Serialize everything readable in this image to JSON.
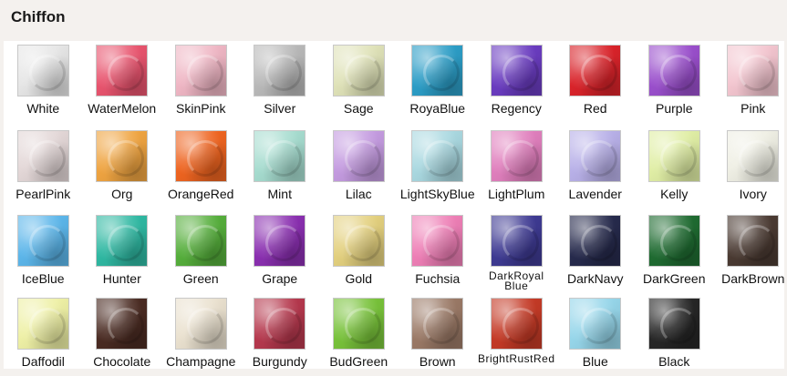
{
  "title": "Chiffon",
  "swatches": [
    {
      "label": "White",
      "color": "#e6e6e6"
    },
    {
      "label": "WaterMelon",
      "color": "#e8546e"
    },
    {
      "label": "SkinPink",
      "color": "#efb6c4"
    },
    {
      "label": "Silver",
      "color": "#b9b9b9"
    },
    {
      "label": "Sage",
      "color": "#dfe2b8"
    },
    {
      "label": "RoyaBlue",
      "color": "#2c9dc6"
    },
    {
      "label": "Regency",
      "color": "#6a3cc0"
    },
    {
      "label": "Red",
      "color": "#d9232a"
    },
    {
      "label": "Purple",
      "color": "#9a4fcc"
    },
    {
      "label": "Pink",
      "color": "#f3c5cf"
    },
    {
      "label": "PearlPink",
      "color": "#e3d7d7"
    },
    {
      "label": "Org",
      "color": "#efa441"
    },
    {
      "label": "OrangeRed",
      "color": "#ee6420"
    },
    {
      "label": "Mint",
      "color": "#a6dccf"
    },
    {
      "label": "Lilac",
      "color": "#c49be0"
    },
    {
      "label": "LightSkyBlue",
      "color": "#a9d8e0"
    },
    {
      "label": "LightPlum",
      "color": "#e07fbd"
    },
    {
      "label": "Lavender",
      "color": "#b8b0e8"
    },
    {
      "label": "Kelly",
      "color": "#e0eea5"
    },
    {
      "label": "Ivory",
      "color": "#efefe4"
    },
    {
      "label": "IceBlue",
      "color": "#5cb6ea"
    },
    {
      "label": "Hunter",
      "color": "#2fb8a2"
    },
    {
      "label": "Green",
      "color": "#55ae3b"
    },
    {
      "label": "Grape",
      "color": "#8a2fb0"
    },
    {
      "label": "Gold",
      "color": "#e3d07e"
    },
    {
      "label": "Fuchsia",
      "color": "#ee7fb6"
    },
    {
      "label": "DarkRoyal Blue",
      "color": "#3e3a92"
    },
    {
      "label": "DarkNavy",
      "color": "#262a4c"
    },
    {
      "label": "DarkGreen",
      "color": "#1f6b31"
    },
    {
      "label": "DarkBrown",
      "color": "#4a3a32"
    },
    {
      "label": "Daffodil",
      "color": "#eef0a5"
    },
    {
      "label": "Chocolate",
      "color": "#4a2b22"
    },
    {
      "label": "Champagne",
      "color": "#eae1cf"
    },
    {
      "label": "Burgundy",
      "color": "#b5384d"
    },
    {
      "label": "BudGreen",
      "color": "#78c23a"
    },
    {
      "label": "Brown",
      "color": "#9a7966"
    },
    {
      "label": "BrightRustRed",
      "color": "#c43a26"
    },
    {
      "label": "Blue",
      "color": "#96d6ea"
    },
    {
      "label": "Black",
      "color": "#262626"
    }
  ]
}
